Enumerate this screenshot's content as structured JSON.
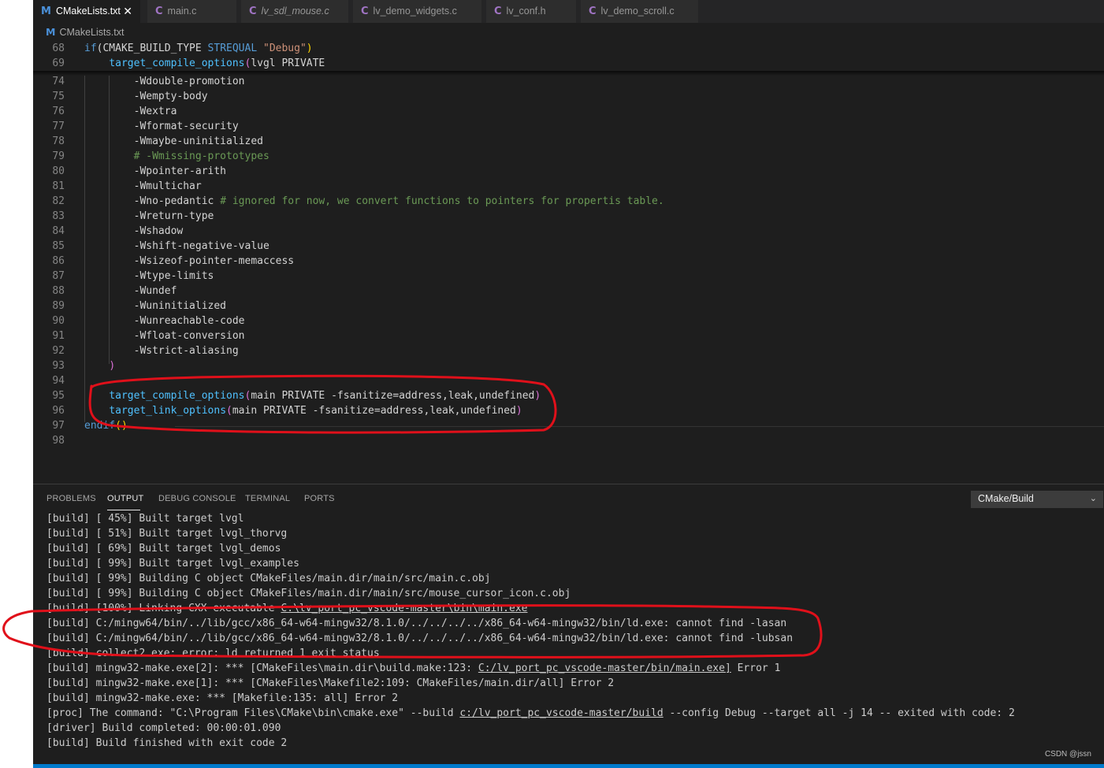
{
  "tabs": [
    {
      "icon": "M",
      "icon_type": "cmake",
      "label": "CMakeLists.txt",
      "active": true,
      "close": "✕"
    },
    {
      "icon": "C",
      "icon_type": "c",
      "label": "main.c",
      "active": false
    },
    {
      "icon": "C",
      "icon_type": "c",
      "label": "lv_sdl_mouse.c",
      "active": false,
      "italic": true
    },
    {
      "icon": "C",
      "icon_type": "c",
      "label": "lv_demo_widgets.c",
      "active": false
    },
    {
      "icon": "C",
      "icon_type": "c",
      "label": "lv_conf.h",
      "active": false
    },
    {
      "icon": "C",
      "icon_type": "c",
      "label": "lv_demo_scroll.c",
      "active": false
    }
  ],
  "breadcrumb": {
    "icon": "M",
    "label": "CMakeLists.txt"
  },
  "editor": {
    "lines": [
      {
        "n": "68",
        "segs": [
          {
            "t": "if",
            "c": "kw"
          },
          {
            "t": "(CMAKE_BUILD_TYPE "
          },
          {
            "t": "STREQUAL",
            "c": "kw"
          },
          {
            "t": " "
          },
          {
            "t": "\"Debug\"",
            "c": "str"
          },
          {
            "t": ")",
            "c": "paren"
          }
        ]
      },
      {
        "n": "69",
        "segs": [
          {
            "t": "    "
          },
          {
            "t": "target_compile_options",
            "c": "fn"
          },
          {
            "t": "(",
            "c": "paren2"
          },
          {
            "t": "lvgl PRIVATE"
          }
        ]
      },
      {
        "n": "74",
        "segs": [
          {
            "t": "        -Wdouble-promotion"
          }
        ]
      },
      {
        "n": "75",
        "segs": [
          {
            "t": "        -Wempty-body"
          }
        ]
      },
      {
        "n": "76",
        "segs": [
          {
            "t": "        -Wextra"
          }
        ]
      },
      {
        "n": "77",
        "segs": [
          {
            "t": "        -Wformat-security"
          }
        ]
      },
      {
        "n": "78",
        "segs": [
          {
            "t": "        -Wmaybe-uninitialized"
          }
        ]
      },
      {
        "n": "79",
        "segs": [
          {
            "t": "        # -Wmissing-prototypes",
            "c": "cm"
          }
        ]
      },
      {
        "n": "80",
        "segs": [
          {
            "t": "        -Wpointer-arith"
          }
        ]
      },
      {
        "n": "81",
        "segs": [
          {
            "t": "        -Wmultichar"
          }
        ]
      },
      {
        "n": "82",
        "segs": [
          {
            "t": "        -Wno-pedantic "
          },
          {
            "t": "# ignored for now, we convert functions to pointers for propertis table.",
            "c": "cm"
          }
        ]
      },
      {
        "n": "83",
        "segs": [
          {
            "t": "        -Wreturn-type"
          }
        ]
      },
      {
        "n": "84",
        "segs": [
          {
            "t": "        -Wshadow"
          }
        ]
      },
      {
        "n": "85",
        "segs": [
          {
            "t": "        -Wshift-negative-value"
          }
        ]
      },
      {
        "n": "86",
        "segs": [
          {
            "t": "        -Wsizeof-pointer-memaccess"
          }
        ]
      },
      {
        "n": "87",
        "segs": [
          {
            "t": "        -Wtype-limits"
          }
        ]
      },
      {
        "n": "88",
        "segs": [
          {
            "t": "        -Wundef"
          }
        ]
      },
      {
        "n": "89",
        "segs": [
          {
            "t": "        -Wuninitialized"
          }
        ]
      },
      {
        "n": "90",
        "segs": [
          {
            "t": "        -Wunreachable-code"
          }
        ]
      },
      {
        "n": "91",
        "segs": [
          {
            "t": "        -Wfloat-conversion"
          }
        ]
      },
      {
        "n": "92",
        "segs": [
          {
            "t": "        -Wstrict-aliasing"
          }
        ]
      },
      {
        "n": "93",
        "segs": [
          {
            "t": "    "
          },
          {
            "t": ")",
            "c": "paren2"
          }
        ]
      },
      {
        "n": "94",
        "segs": []
      },
      {
        "n": "95",
        "segs": [
          {
            "t": "    "
          },
          {
            "t": "target_compile_options",
            "c": "fn"
          },
          {
            "t": "(",
            "c": "paren2"
          },
          {
            "t": "main PRIVATE -fsanitize=address,leak,undefined"
          },
          {
            "t": ")",
            "c": "paren2"
          }
        ]
      },
      {
        "n": "96",
        "segs": [
          {
            "t": "    "
          },
          {
            "t": "target_link_options",
            "c": "fn"
          },
          {
            "t": "(",
            "c": "paren2"
          },
          {
            "t": "main PRIVATE -fsanitize=address,leak,undefined"
          },
          {
            "t": ")",
            "c": "paren2"
          }
        ]
      },
      {
        "n": "97",
        "segs": [
          {
            "t": "endif",
            "c": "kw"
          },
          {
            "t": "()",
            "c": "paren"
          }
        ]
      },
      {
        "n": "98",
        "segs": []
      }
    ]
  },
  "panel": {
    "tabs": [
      "PROBLEMS",
      "OUTPUT",
      "DEBUG CONSOLE",
      "TERMINAL",
      "PORTS"
    ],
    "active_tab": "OUTPUT",
    "channel": "CMake/Build",
    "output": [
      {
        "segs": [
          {
            "t": "[build] [ 45%] Built target lvgl"
          }
        ]
      },
      {
        "segs": [
          {
            "t": "[build] [ 51%] Built target lvgl_thorvg"
          }
        ]
      },
      {
        "segs": [
          {
            "t": "[build] [ 69%] Built target lvgl_demos"
          }
        ]
      },
      {
        "segs": [
          {
            "t": "[build] [ 99%] Built target lvgl_examples"
          }
        ]
      },
      {
        "segs": [
          {
            "t": "[build] [ 99%] Building C object CMakeFiles/main.dir/main/src/main.c.obj"
          }
        ]
      },
      {
        "segs": [
          {
            "t": "[build] [ 99%] Building C object CMakeFiles/main.dir/main/src/mouse_cursor_icon.c.obj"
          }
        ]
      },
      {
        "segs": [
          {
            "t": "[build] [100%] Linking CXX executable "
          },
          {
            "t": "C:\\lv_port_pc_vscode-master\\bin\\main.exe",
            "link": true
          }
        ]
      },
      {
        "segs": [
          {
            "t": "[build] C:/mingw64/bin/../lib/gcc/x86_64-w64-mingw32/8.1.0/../../../../x86_64-w64-mingw32/bin/ld.exe: cannot find -lasan"
          }
        ]
      },
      {
        "segs": [
          {
            "t": "[build] C:/mingw64/bin/../lib/gcc/x86_64-w64-mingw32/8.1.0/../../../../x86_64-w64-mingw32/bin/ld.exe: cannot find -lubsan"
          }
        ]
      },
      {
        "segs": [
          {
            "t": "[build] collect2.exe: error: ld returned 1 exit status"
          }
        ]
      },
      {
        "segs": [
          {
            "t": "[build] mingw32-make.exe[2]: *** [CMakeFiles\\main.dir\\build.make:123: "
          },
          {
            "t": "C:/lv_port_pc_vscode-master/bin/main.exe]",
            "link": true
          },
          {
            "t": " Error 1"
          }
        ]
      },
      {
        "segs": [
          {
            "t": "[build] mingw32-make.exe[1]: *** [CMakeFiles\\Makefile2:109: CMakeFiles/main.dir/all] Error 2"
          }
        ]
      },
      {
        "segs": [
          {
            "t": "[build] mingw32-make.exe: *** [Makefile:135: all] Error 2"
          }
        ]
      },
      {
        "segs": [
          {
            "t": "[proc] The command: \"C:\\Program Files\\CMake\\bin\\cmake.exe\" --build "
          },
          {
            "t": "c:/lv_port_pc_vscode-master/build",
            "link": true
          },
          {
            "t": " --config Debug --target all -j 14 -- exited with code: 2"
          }
        ]
      },
      {
        "segs": [
          {
            "t": "[driver] Build completed: 00:00:01.090"
          }
        ]
      },
      {
        "segs": [
          {
            "t": "[build] Build finished with exit code 2"
          }
        ]
      }
    ]
  },
  "watermark": "CSDN @jssn",
  "colors": {
    "background": "#1e1e1e",
    "keyword": "#569cd6",
    "function": "#4fc1ff",
    "string": "#ce9178",
    "comment": "#6a9955",
    "annotation": "#e0101a",
    "status_bar": "#007acc"
  }
}
